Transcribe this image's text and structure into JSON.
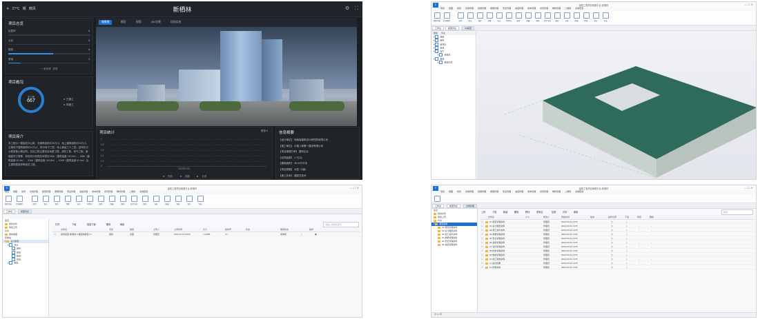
{
  "dashboard": {
    "title": "新栖林",
    "weather": {
      "temp": "27℃",
      "desc": "晴",
      "wind": "微风"
    },
    "tabs": [
      "效果图",
      "模型",
      "视频",
      "360全景",
      "现场实拍"
    ],
    "progress": {
      "title": "项目总览",
      "rows": [
        {
          "label": "批复率",
          "value": "0",
          "fraction": 0.0
        },
        {
          "label": "目标",
          "value": "0",
          "fraction": 0.0
        },
        {
          "label": "模型",
          "value": "4",
          "fraction": 0.55
        },
        {
          "label": "基础",
          "value": "1",
          "fraction": 0.15
        }
      ],
      "legend": [
        "未完成",
        "完成"
      ]
    },
    "overview": {
      "title": "项目概况",
      "ring_label": "总工程",
      "ring_value": "667",
      "legend": [
        "已施工",
        "拟施工"
      ],
      "ring_fraction": 0.8
    },
    "intro": {
      "title": "项目简介",
      "text": "本工程为一幢高层办公楼，总建筑面积约36万㎡，地上建筑面积约24万㎡，主楼地下建筑面积约12万㎡，其中地下三层，地上最高三十三层；结构形式为框架核心筒结构。包括工程主要包括地基工程、消防工程、电气工程、幕墙装饰工程等。标段划分参照总体规划 B6A（建筑高度 149.8m）、B6B（建筑高度 62.4m）、ID6A（建筑高度 149.8m）、ID6B（建筑高度 62.4m）及主楼附属裙房等相关工程。"
    },
    "stats": {
      "title": "项目统计",
      "more": "更多",
      "y_ticks": [
        "1",
        "0.8",
        "0.6",
        "0.4",
        "0.2",
        "0"
      ],
      "x_label": "2022年04月",
      "legend": [
        "任务",
        "问题",
        "计划"
      ]
    },
    "info": {
      "title": "信息概要",
      "rows": [
        "【设计单位】 河南省建筑设计研究院有限公司",
        "【施工单位】 中建八局第一建设有限公司",
        "【项目管理方单】 建科企业",
        "【合同金额】 1.7亿元",
        "【建筑面积】 38.33万平米",
        "【项目规模】 大型（2级）",
        "【施工技术】 装配式技术"
      ]
    }
  },
  "model_window": {
    "title": "建筑工程项目管理平台-新栖林",
    "menus": [
      "项目",
      "视图",
      "协同",
      "文档管理",
      "权限管理",
      "质量管理",
      "安全管理",
      "进度管理",
      "成本管理",
      "合同管理",
      "物料管理",
      "二维码",
      "系统配置"
    ],
    "ribbon": [
      "模型浏览",
      "打开模型",
      "剖切",
      "视点",
      "漫游",
      "测量",
      "标注",
      "构件树",
      "属性",
      "隐藏",
      "隔离",
      "显示全部",
      "图层",
      "分析",
      "碰撞",
      "审核",
      "批注",
      "导出"
    ],
    "doc_tabs": [
      "工作台",
      "模型列表",
      "3D模型"
    ],
    "tree_header": [
      "楼层",
      "专业"
    ],
    "tree": [
      "建筑",
      "结构",
      "给排水",
      "暖通",
      "电气",
      "智能化",
      "幕墙",
      "幕墙主体"
    ]
  },
  "docs_window": {
    "title": "建筑工程项目管理平台-新栖林",
    "doc_tabs": [
      "工作台",
      "模型列表"
    ],
    "toolbar": [
      "打开",
      "下载",
      "批量下载",
      "删除",
      "刷新"
    ],
    "search_placeholder": "请输入搜索关键字",
    "tree": [
      "最近",
      "我的文件",
      "我的上传",
      "共享",
      "我的收藏",
      "回收站",
      "设计模型",
      "专业",
      "结构",
      "建筑",
      "暖通",
      "机电",
      "模型"
    ],
    "columns": [
      "文件名",
      "专业",
      "楼层",
      "上传人",
      "上传时间",
      "大小",
      "版本号",
      "状态",
      "审批状态",
      "操作"
    ],
    "rows": [
      [
        "建筑模型-新栖林 A 楼结构模型.rvt",
        "结构",
        "全部",
        "管理员",
        "2022-03-12 09:59",
        "7.42MB",
        "V.1",
        "",
        "未审核",
        ""
      ]
    ]
  },
  "files_window": {
    "title": "建筑工程项目管理平台-新栖林",
    "doc_tabs": [
      "工作台",
      "模型列表",
      "文档管理"
    ],
    "toolbar": [
      "上传",
      "下载",
      "新建",
      "删除",
      "移动",
      "重命名",
      "复制",
      "共享",
      "刷新",
      "搜索"
    ],
    "search_placeholder": "搜索",
    "columns": [
      "文件名",
      "大小",
      "修改人",
      "修改时间",
      "版本",
      "操作记录",
      "下载",
      "预览",
      "删除"
    ],
    "rows": [
      [
        "01-项目管理资料",
        "",
        "管理员",
        "2022-03-01 10:05"
      ],
      [
        "02-设计图纸资料",
        "",
        "管理员",
        "2022-03-01 10:05"
      ],
      [
        "03-施工技术资料",
        "",
        "管理员",
        "2022-03-01 10:05"
      ],
      [
        "04-质量管理资料",
        "",
        "管理员",
        "2022-03-01 10:05"
      ],
      [
        "05-安全管理资料",
        "",
        "管理员",
        "2022-03-01 10:05"
      ],
      [
        "06-进度管理资料",
        "",
        "管理员",
        "2022-03-01 10:05"
      ],
      [
        "07-合同管理资料",
        "",
        "管理员",
        "2022-03-01 10:05"
      ],
      [
        "08-成本管理资料",
        "",
        "管理员",
        "2022-03-01 10:05"
      ],
      [
        "09-物资管理资料",
        "",
        "管理员",
        "2022-03-01 10:05"
      ],
      [
        "10-竣工验收资料",
        "",
        "管理员",
        "2022-03-01 10:05"
      ],
      [
        "11-会议纪要",
        "",
        "管理员",
        "2022-03-01 10:05"
      ],
      [
        "12-影像资料",
        "",
        "管理员",
        "2022-03-01 10:05"
      ]
    ],
    "tree": [
      "最近",
      "我的文件",
      "我的上传",
      "共享",
      "项目资料"
    ],
    "status": "共 12 项"
  }
}
